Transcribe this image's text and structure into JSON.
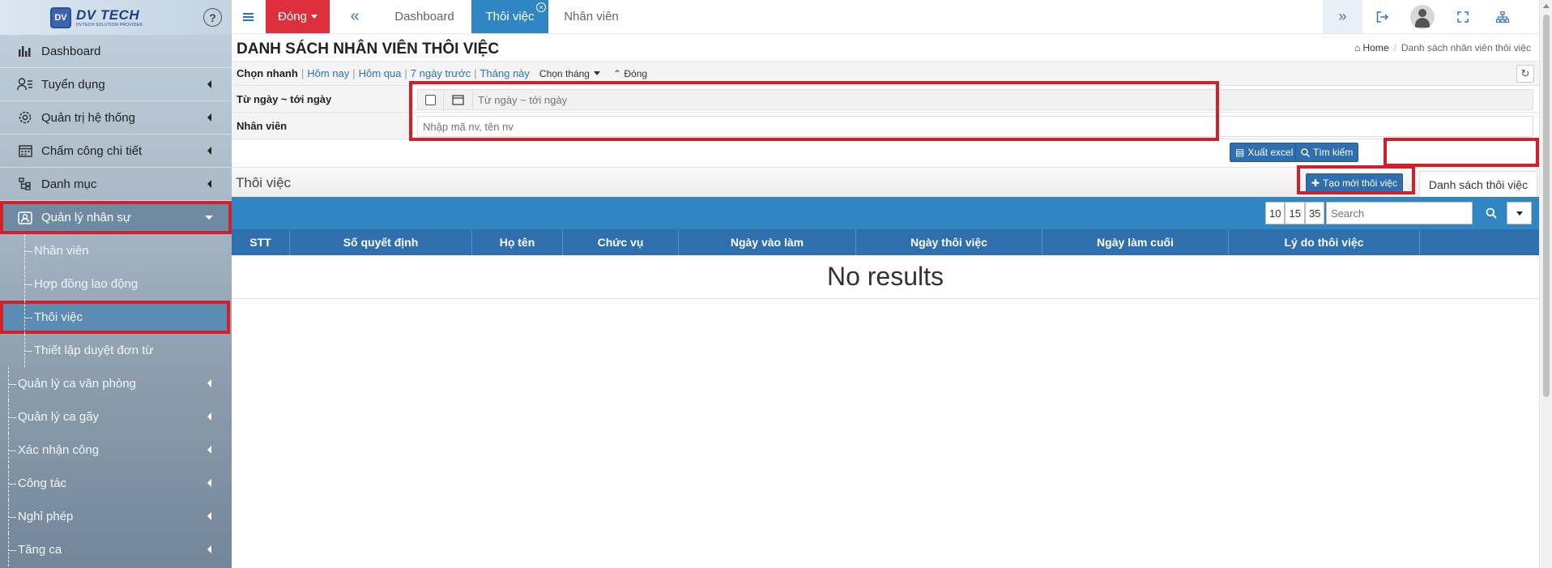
{
  "app": {
    "logo_text": "DV TECH",
    "logo_sub": "DVTECH SOLUTION PROVIDER"
  },
  "sidebar": {
    "items": [
      {
        "label": "Dashboard",
        "icon": "bar-chart-icon"
      },
      {
        "label": "Tuyển dụng",
        "icon": "user-list-icon"
      },
      {
        "label": "Quản trị hệ thống",
        "icon": "gear-icon"
      },
      {
        "label": "Chấm công chi tiết",
        "icon": "calendar-icon"
      },
      {
        "label": "Danh mục",
        "icon": "tree-icon"
      },
      {
        "label": "Quản lý nhân sự",
        "icon": "id-card-icon"
      }
    ],
    "sub_items": [
      {
        "label": "Nhân viên"
      },
      {
        "label": "Hợp đồng lao động"
      },
      {
        "label": "Thôi việc"
      },
      {
        "label": "Thiết lập duyệt đơn từ"
      }
    ],
    "tree_items": [
      {
        "label": "Quản lý ca văn phòng"
      },
      {
        "label": "Quản lý ca gãy"
      },
      {
        "label": "Xác nhận công"
      },
      {
        "label": "Công tác"
      },
      {
        "label": "Nghỉ phép"
      },
      {
        "label": "Tăng ca"
      }
    ]
  },
  "topbar": {
    "dong_label": "Đóng",
    "tabs": [
      {
        "label": "Dashboard"
      },
      {
        "label": "Thôi việc"
      },
      {
        "label": "Nhân viên"
      }
    ]
  },
  "page": {
    "title": "DANH SÁCH NHÂN VIÊN THÔI VIỆC",
    "breadcrumb_home": "Home",
    "breadcrumb_current": "Danh sách nhân viên thôi việc"
  },
  "quick": {
    "label": "Chọn nhanh",
    "links": [
      "Hôm nay",
      "Hôm qua",
      "7 ngày trước",
      "Tháng này"
    ],
    "month_label": "Chọn tháng",
    "close_label": "Đóng"
  },
  "filters": {
    "date_label": "Từ ngày ~ tới ngày",
    "date_placeholder": "Từ ngày ~ tới ngày",
    "employee_label": "Nhân viên",
    "employee_placeholder": "Nhập mã nv, tên nv"
  },
  "actions": {
    "excel_label": "Xuất excel",
    "search_label": "Tìm kiếm"
  },
  "section": {
    "title": "Thôi việc",
    "create_label": "Tạo mới thôi việc",
    "list_tab_label": "Danh sách thôi việc"
  },
  "table": {
    "page_sizes": [
      "10",
      "15",
      "35"
    ],
    "search_placeholder": "Search",
    "columns": [
      "STT",
      "Số quyết định",
      "Họ tên",
      "Chức vụ",
      "Ngày vào làm",
      "Ngày thôi việc",
      "Ngày làm cuối",
      "Lý do thôi việc",
      ""
    ],
    "empty_text": "No results"
  },
  "colors": {
    "accent_blue": "#2f86c2",
    "header_blue": "#2f6fad",
    "danger_red": "#dd2f3c",
    "highlight_red": "#d0202c"
  }
}
